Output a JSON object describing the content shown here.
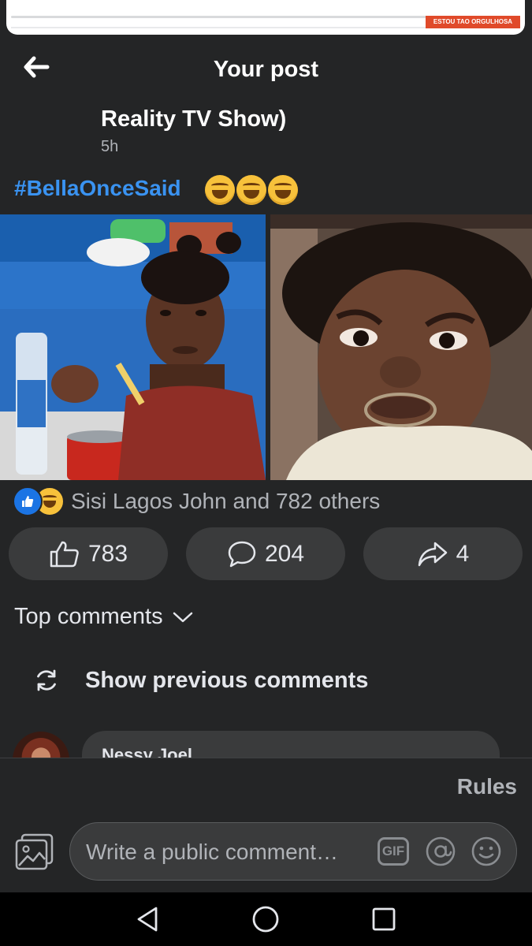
{
  "top_banner": {
    "tag_text": "ESTOU TAO ORGULHOSA"
  },
  "header": {
    "title": "Your post",
    "back_icon": "arrow-left-icon"
  },
  "post": {
    "page_name": "Reality TV Show)",
    "time": "5h",
    "hashtag": "#BellaOnceSaid",
    "emoji_count": 3,
    "images": [
      {
        "description": "woman-eating-frown"
      },
      {
        "description": "child-frown"
      }
    ]
  },
  "reactions": {
    "icons": [
      "like-icon",
      "haha-icon"
    ],
    "summary": "Sisi Lagos John and 782 others"
  },
  "actions": {
    "like_count": "783",
    "comment_count": "204",
    "share_count": "4"
  },
  "comments": {
    "sort_label": "Top comments",
    "show_previous": "Show previous comments",
    "first_commenter": "Nessy Joel"
  },
  "composer": {
    "rules_label": "Rules",
    "placeholder": "Write a public comment…",
    "gif_label": "GIF"
  },
  "colors": {
    "background": "#242526",
    "button": "#3a3b3c",
    "accent": "#3a93f1",
    "like_blue": "#1b74e4"
  }
}
